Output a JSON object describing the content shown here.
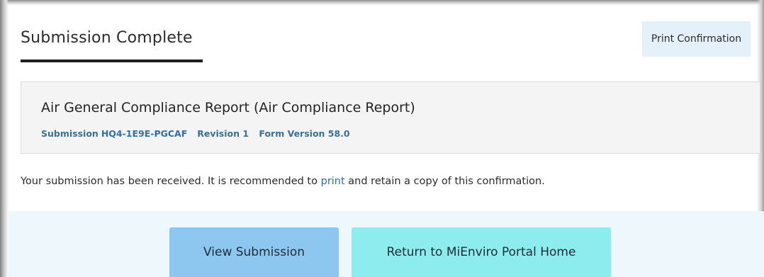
{
  "header": {
    "title": "Submission Complete",
    "print_button_label": "Print Confirmation"
  },
  "report": {
    "title": "Air General Compliance Report (Air Compliance Report)",
    "submission_label": "Submission",
    "submission_id": "HQ4-1E9E-PGCAF",
    "revision": "Revision 1",
    "form_version": "Form Version 58.0"
  },
  "message": {
    "before_link": "Your submission has been received. It is recommended to ",
    "link_text": "print",
    "after_link": " and retain a copy of this confirmation."
  },
  "actions": {
    "view_label": "View Submission",
    "home_label": "Return to MiEnviro Portal Home"
  },
  "colors": {
    "view_button": "#8dc6ef",
    "home_button": "#8cecee",
    "print_button": "#e5f1fa",
    "link": "#2f6fa9",
    "action_band": "#edf7fc"
  }
}
